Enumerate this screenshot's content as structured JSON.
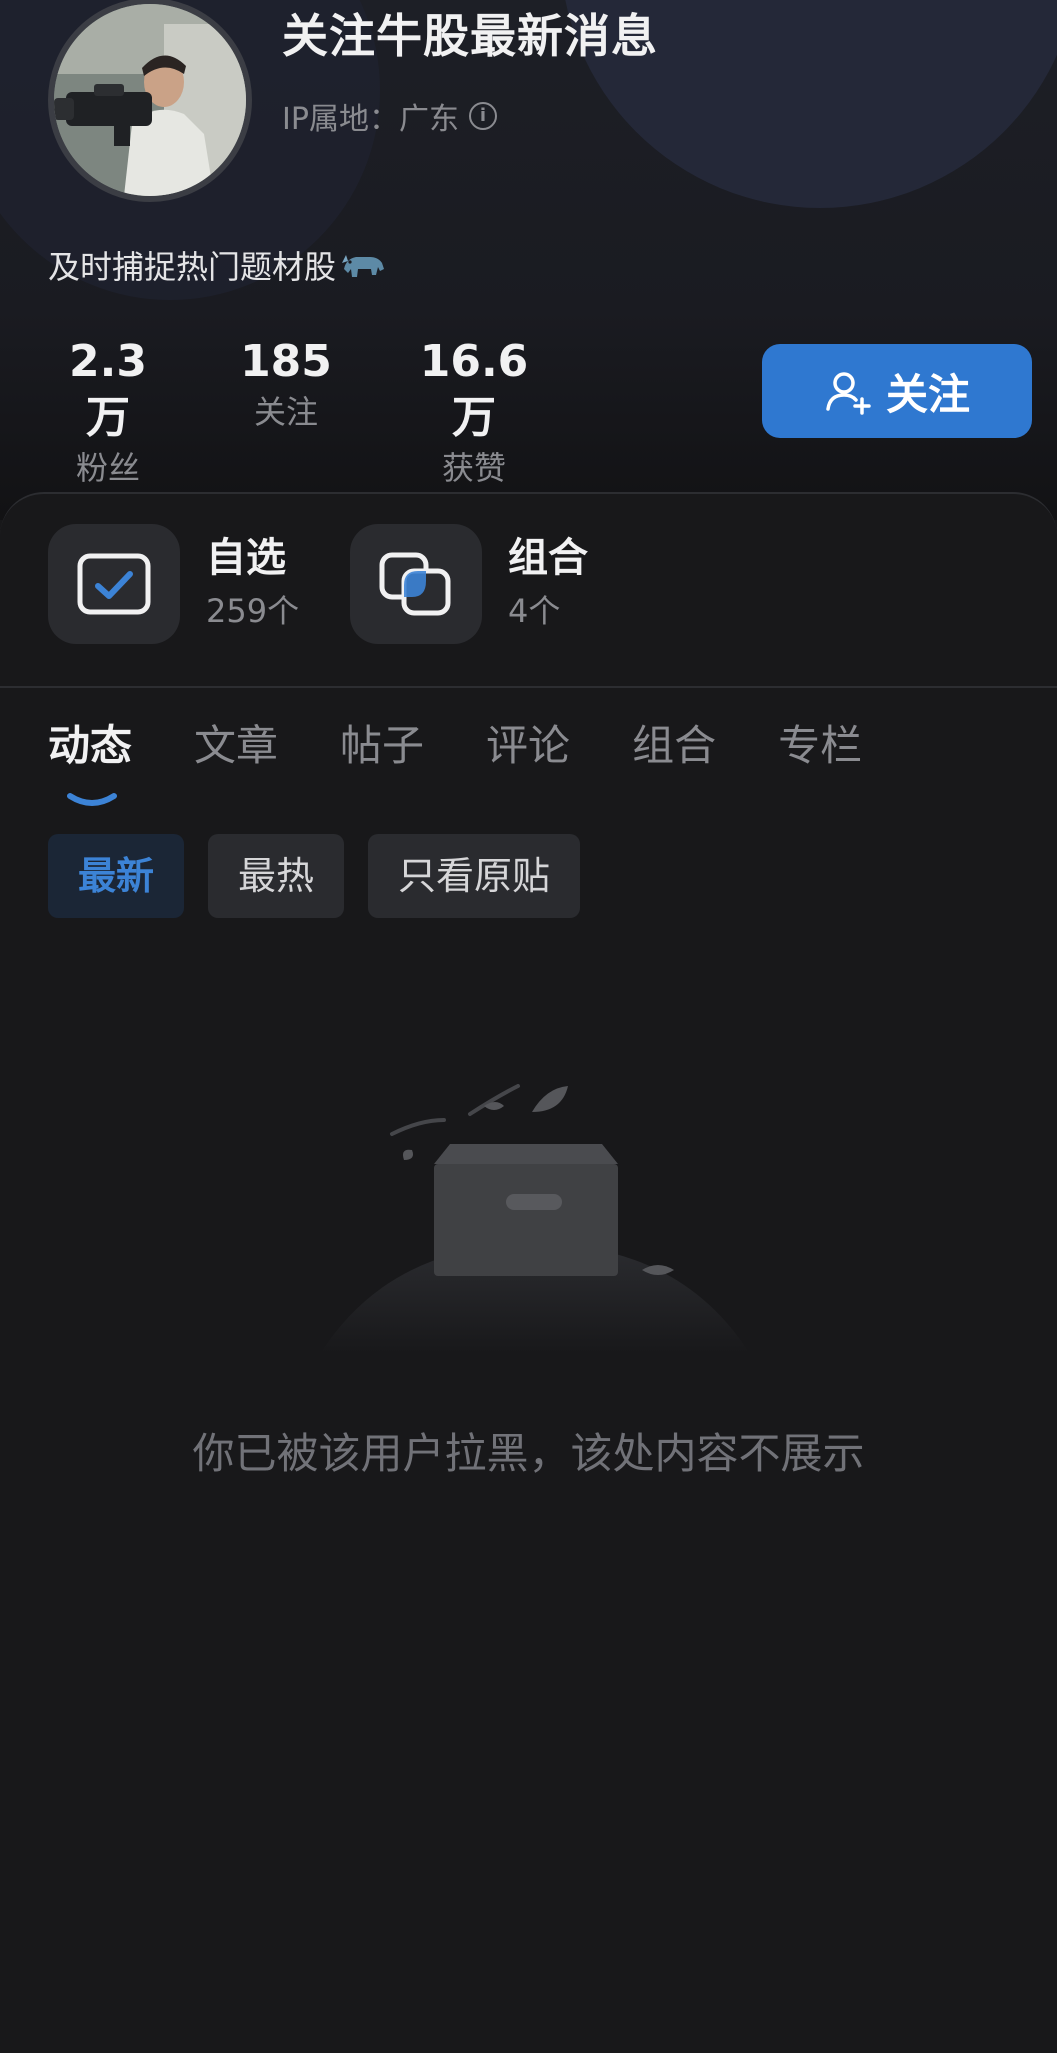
{
  "profile": {
    "name": "关注牛股最新消息",
    "ip_label": "IP属地：广东",
    "bio": "及时捕捉热门题材股"
  },
  "stats": [
    {
      "value": "2.3万",
      "label": "粉丝"
    },
    {
      "value": "185",
      "label": "关注"
    },
    {
      "value": "16.6万",
      "label": "获赞"
    }
  ],
  "follow_button": {
    "label": "关注"
  },
  "shortcuts": [
    {
      "title": "自选",
      "count": "259个",
      "icon": "checkbox-icon"
    },
    {
      "title": "组合",
      "count": "4个",
      "icon": "overlap-squares-icon"
    }
  ],
  "tabs": [
    {
      "label": "动态",
      "active": true
    },
    {
      "label": "文章"
    },
    {
      "label": "帖子"
    },
    {
      "label": "评论"
    },
    {
      "label": "组合"
    },
    {
      "label": "专栏"
    }
  ],
  "filters": [
    {
      "label": "最新",
      "active": true
    },
    {
      "label": "最热"
    },
    {
      "label": "只看原贴"
    }
  ],
  "empty_state": {
    "message": "你已被该用户拉黑，该处内容不展示",
    "icon": "empty-box-icon"
  },
  "colors": {
    "accent": "#2f78d0",
    "background": "#18181a"
  }
}
